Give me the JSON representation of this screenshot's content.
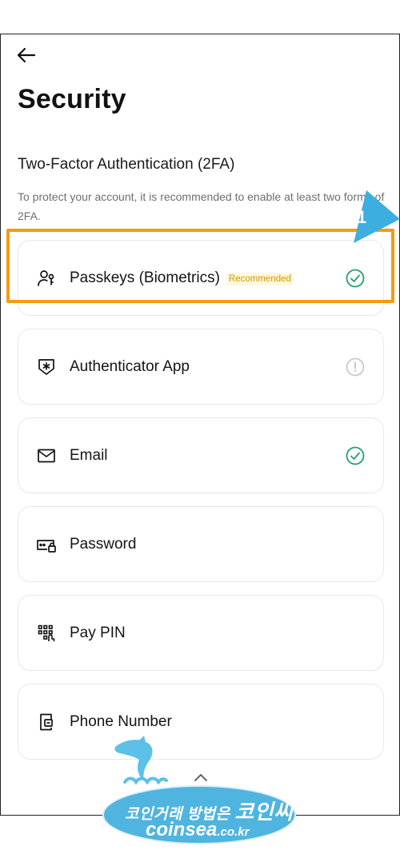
{
  "header": {
    "back_icon": "arrow-left-icon",
    "title": "Security"
  },
  "twofa": {
    "title": "Two-Factor Authentication (2FA)",
    "description": "To protect your account, it is recommended to enable at least two forms of 2FA.",
    "methods": [
      {
        "label": "Passkeys (Biometrics)",
        "badge": "Recommended",
        "icon": "user-key-icon",
        "status": "enabled",
        "status_icon": "check-circle-icon"
      },
      {
        "label": "Authenticator App",
        "icon": "shield-asterisk-icon",
        "status": "not-set",
        "status_icon": "exclamation-circle-icon"
      },
      {
        "label": "Email",
        "icon": "envelope-icon",
        "status": "enabled",
        "status_icon": "check-circle-icon"
      },
      {
        "label": "Password",
        "icon": "password-lock-icon"
      },
      {
        "label": "Pay PIN",
        "icon": "keypad-icon"
      },
      {
        "label": "Phone Number",
        "icon": "phone-icon"
      }
    ]
  },
  "annotation": {
    "number": "1"
  },
  "watermark": {
    "line1_small": "코인거래 방법은",
    "line1_big": "코인씨",
    "line2_main": "coinsea",
    "line2_suffix": ".co.kr"
  },
  "colors": {
    "check": "#20a06a",
    "warn": "#c9c9c9",
    "highlight": "#f39c12",
    "badge_text": "#d29a00",
    "callout": "#3daee0"
  }
}
